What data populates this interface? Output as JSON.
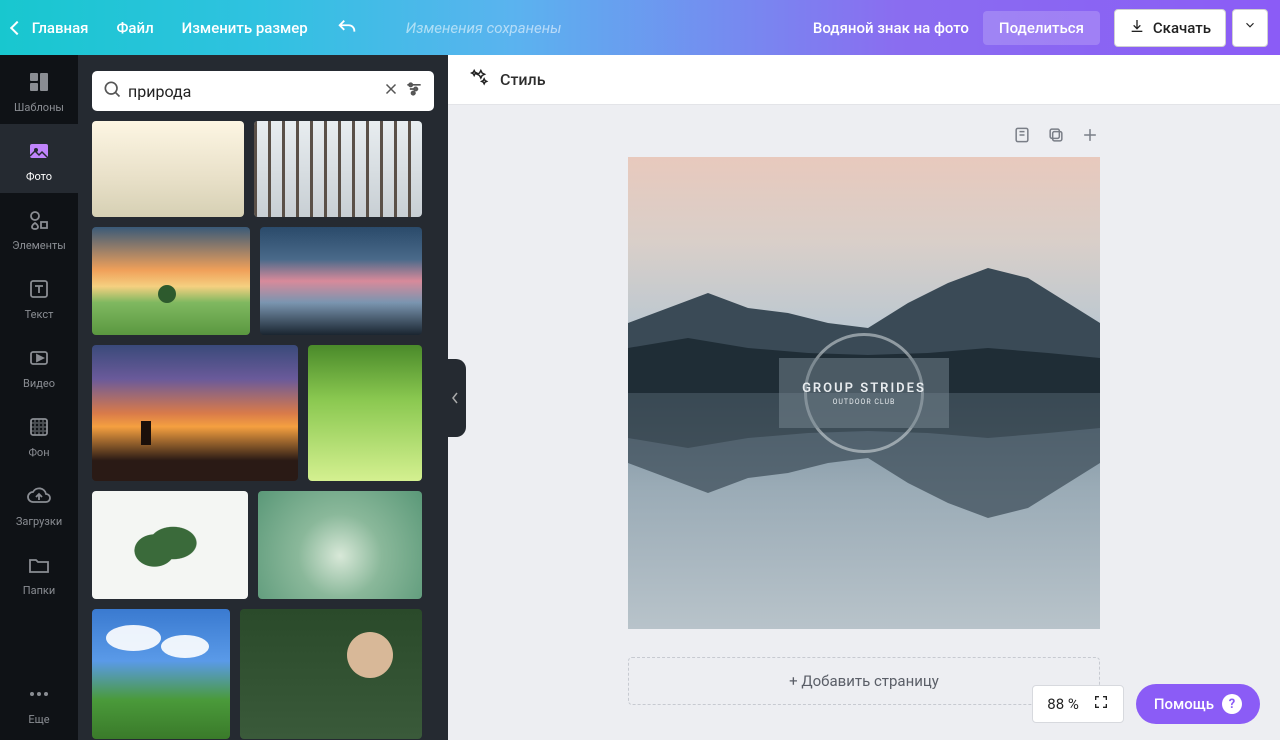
{
  "topbar": {
    "home": "Главная",
    "file": "Файл",
    "resize": "Изменить размер",
    "saved": "Изменения сохранены",
    "watermark": "Водяной знак на фото",
    "share": "Поделиться",
    "download": "Скачать"
  },
  "rail": {
    "templates": "Шаблоны",
    "photos": "Фото",
    "elements": "Элементы",
    "text": "Текст",
    "video": "Видео",
    "background": "Фон",
    "uploads": "Загрузки",
    "folders": "Папки",
    "more": "Еще"
  },
  "search": {
    "value": "природа"
  },
  "stylebar": {
    "label": "Стиль"
  },
  "canvas": {
    "logo_text": "GROUP STRIDES",
    "logo_sub": "OUTDOOR CLUB",
    "add_page": "+ Добавить страницу"
  },
  "zoom": {
    "value": "88 %"
  },
  "help": {
    "label": "Помощь",
    "q": "?"
  }
}
